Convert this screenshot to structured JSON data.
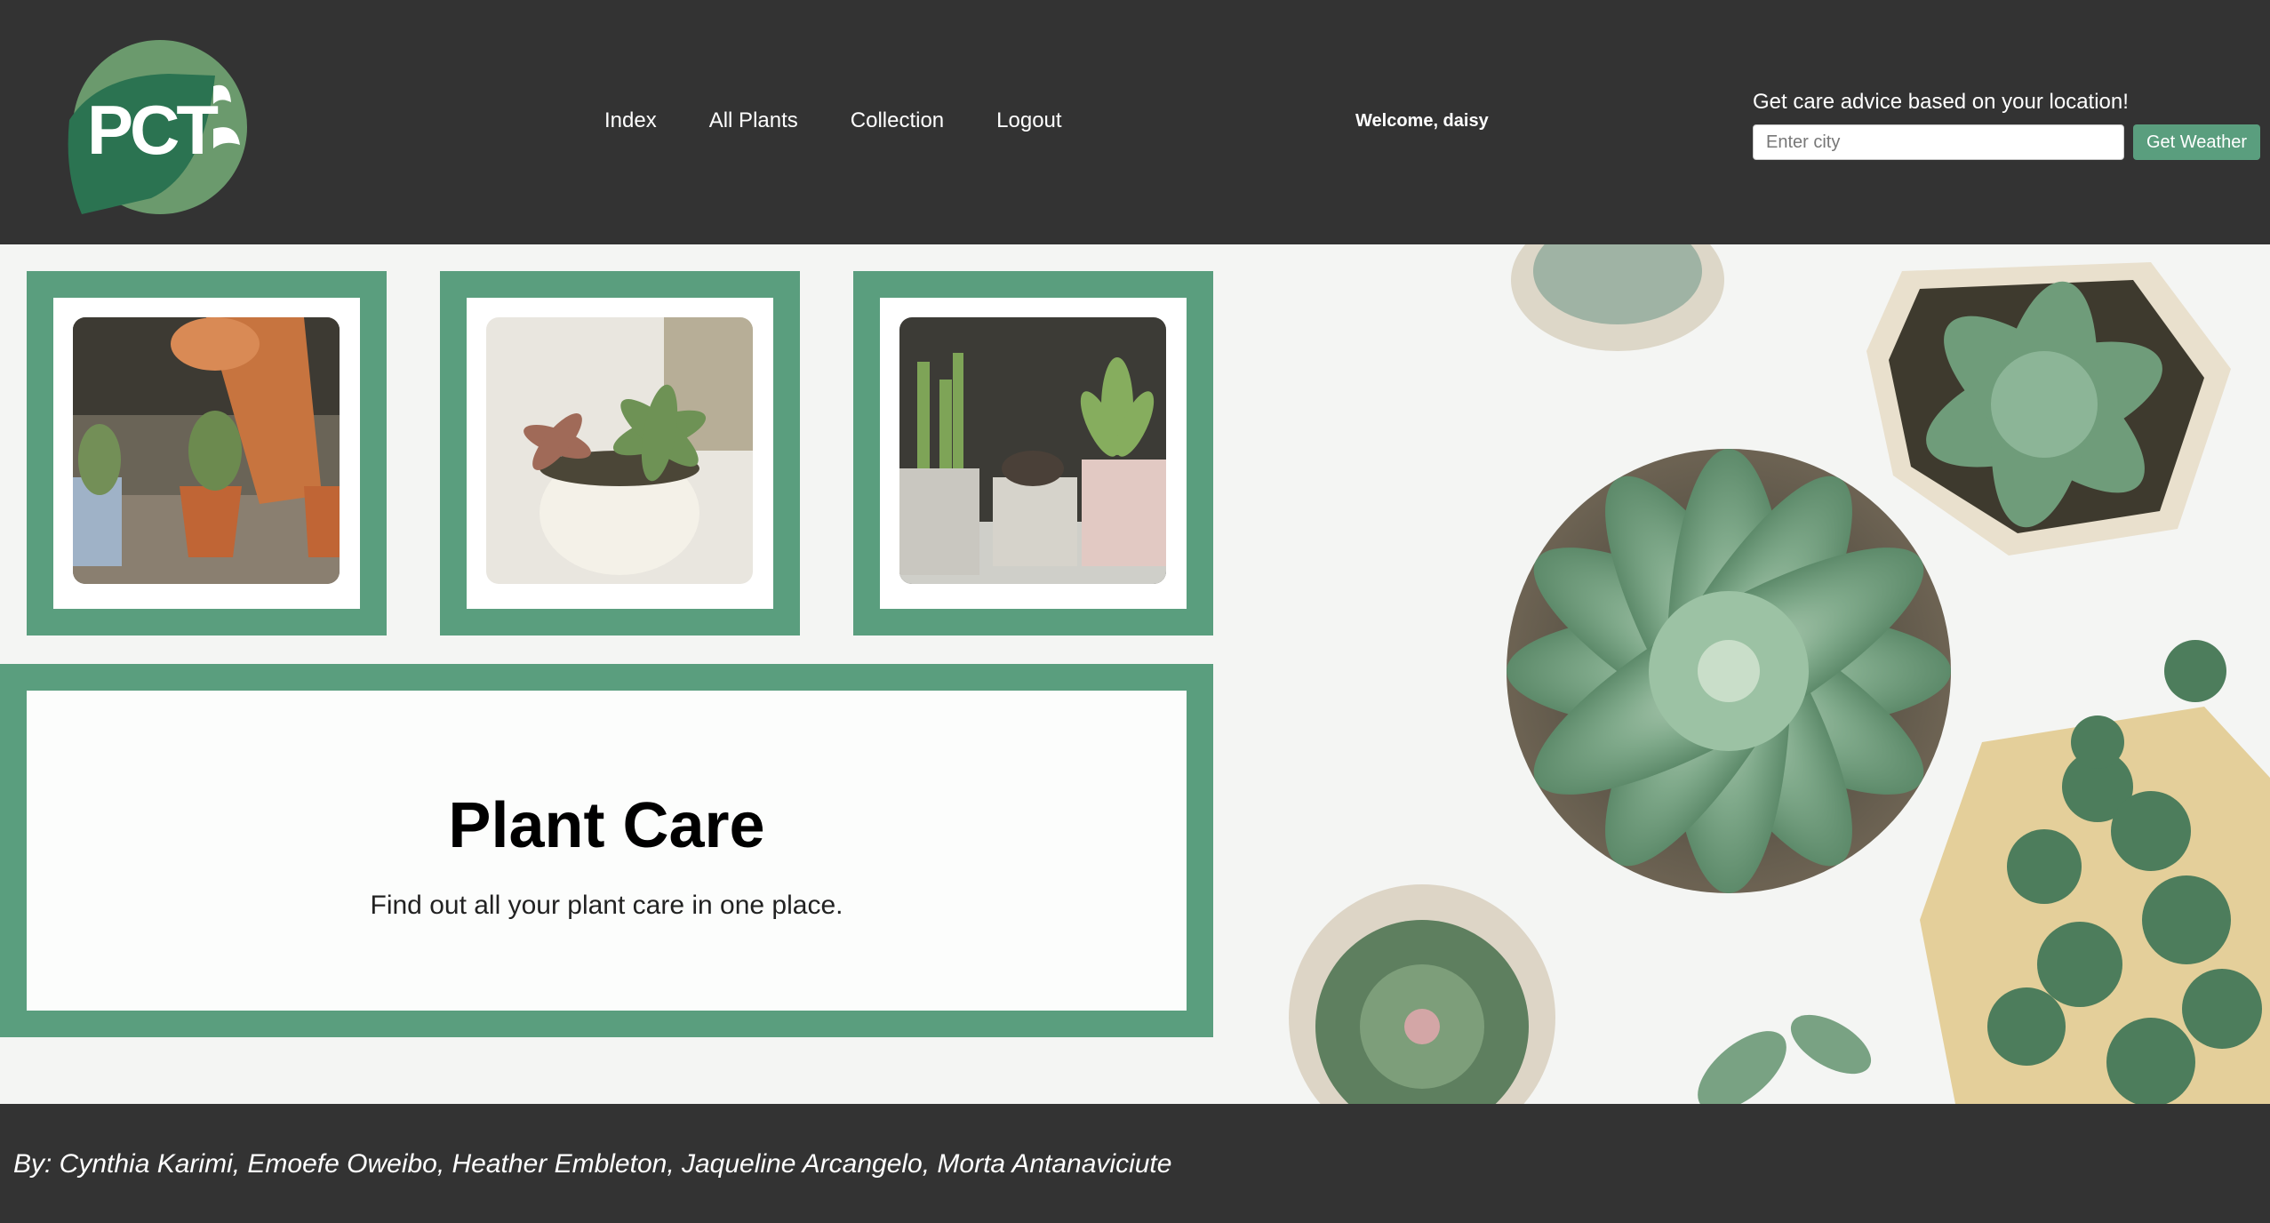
{
  "header": {
    "logo_text": "PCT",
    "nav": [
      "Index",
      "All Plants",
      "Collection",
      "Logout"
    ],
    "welcome": "Welcome, daisy",
    "weather": {
      "label": "Get care advice based on your location!",
      "placeholder": "Enter city",
      "button": "Get Weather"
    }
  },
  "gallery": [
    {
      "icon": "cactus-pots-photo"
    },
    {
      "icon": "succulent-white-pot-photo"
    },
    {
      "icon": "succulent-trio-pots-photo"
    }
  ],
  "hero": {
    "title": "Plant Care",
    "subtitle": "Find out all your plant care in one place."
  },
  "footer": {
    "credits": "By: Cynthia Karimi, Emoefe Oweibo, Heather Embleton, Jaqueline Arcangelo, Morta Antanaviciute"
  },
  "colors": {
    "header_bg": "#333333",
    "accent_green": "#5a9e7e",
    "logo_dark": "#2b7351",
    "logo_light": "#6b9a6d"
  }
}
